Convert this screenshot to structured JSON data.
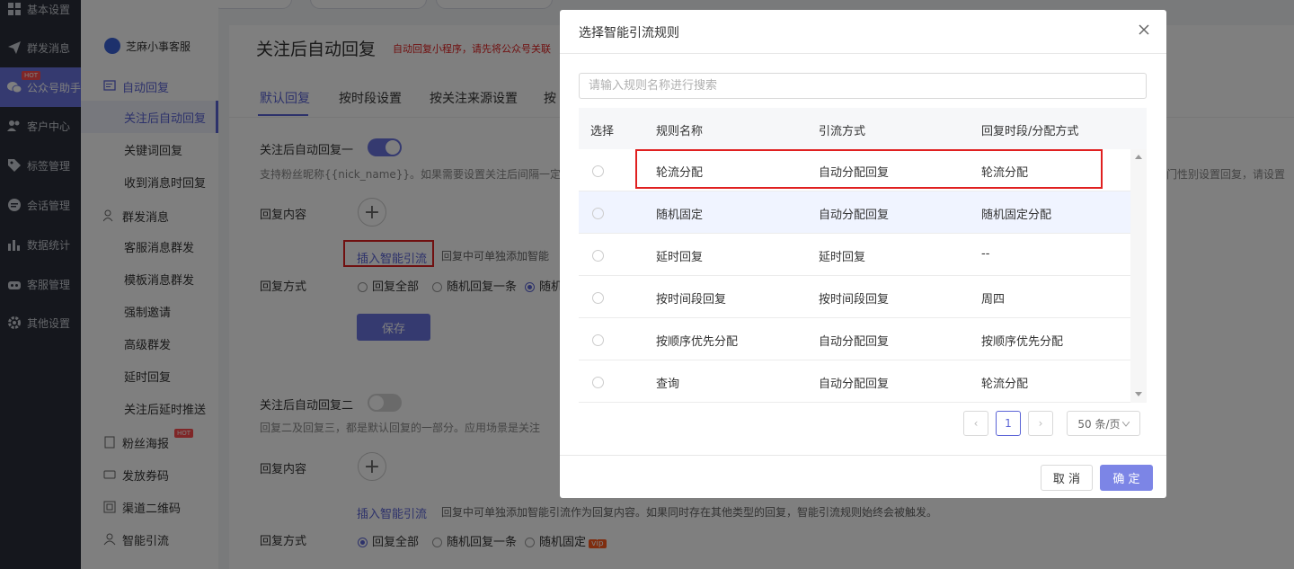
{
  "nav": {
    "items": [
      {
        "label": "基本设置",
        "icon": "grid-icon"
      },
      {
        "label": "群发消息",
        "icon": "send-icon"
      },
      {
        "label": "公众号助手",
        "icon": "wechat-icon",
        "badge": "HOT"
      },
      {
        "label": "客户中心",
        "icon": "users-icon"
      },
      {
        "label": "标签管理",
        "icon": "tag-icon"
      },
      {
        "label": "会话管理",
        "icon": "chat-icon"
      },
      {
        "label": "数据统计",
        "icon": "bar-chart-icon"
      },
      {
        "label": "客服管理",
        "icon": "robot-icon"
      },
      {
        "label": "其他设置",
        "icon": "gear-icon"
      }
    ]
  },
  "side": {
    "app_name": "芝麻小事客服",
    "items": [
      {
        "label": "自动回复",
        "type": "group"
      },
      {
        "label": "关注后自动回复",
        "type": "sub"
      },
      {
        "label": "关键词回复",
        "type": "sub"
      },
      {
        "label": "收到消息时回复",
        "type": "sub"
      },
      {
        "label": "群发消息",
        "type": "group"
      },
      {
        "label": "客服消息群发",
        "type": "sub"
      },
      {
        "label": "模板消息群发",
        "type": "sub"
      },
      {
        "label": "强制邀请",
        "type": "sub"
      },
      {
        "label": "高级群发",
        "type": "sub"
      },
      {
        "label": "延时回复",
        "type": "sub"
      },
      {
        "label": "关注后延时推送",
        "type": "sub"
      },
      {
        "label": "粉丝海报",
        "type": "group",
        "badge": "HOT"
      },
      {
        "label": "发放券码",
        "type": "group"
      },
      {
        "label": "渠道二维码",
        "type": "group"
      },
      {
        "label": "智能引流",
        "type": "group"
      }
    ]
  },
  "main": {
    "title": "关注后自动回复",
    "title_note": "自动回复小程序，请先将公众号关联",
    "tabs": [
      "默认回复",
      "按时段设置",
      "按关注来源设置",
      "按"
    ],
    "section1": {
      "label": "关注后自动回复一",
      "desc": "支持粉丝昵称{{nick_name}}。如果需要设置关注后间隔一定",
      "desc_right": "门性别设置回复，请设置",
      "content_label": "回复内容",
      "insert_link": "插入智能引流",
      "insert_note": "回复中可单独添加智能",
      "mode_label": "回复方式",
      "modes": [
        "回复全部",
        "随机回复一条",
        "随机"
      ],
      "save": "保存"
    },
    "section2": {
      "label": "关注后自动回复二",
      "desc": "回复二及回复三，都是默认回复的一部分。应用场景是关注",
      "content_label": "回复内容",
      "insert_link": "插入智能引流",
      "insert_note": "回复中可单独添加智能引流作为回复内容。如果同时存在其他类型的回复，智能引流规则始终会被触发。",
      "mode_label": "回复方式",
      "modes": [
        "回复全部",
        "随机回复一条",
        "随机固定"
      ],
      "vip": "vip"
    }
  },
  "dialog": {
    "title": "选择智能引流规则",
    "search_placeholder": "请输入规则名称进行搜索",
    "headers": [
      "选择",
      "规则名称",
      "引流方式",
      "回复时段/分配方式"
    ],
    "rows": [
      {
        "name": "轮流分配",
        "method": "自动分配回复",
        "period": "轮流分配"
      },
      {
        "name": "随机固定",
        "method": "自动分配回复",
        "period": "随机固定分配"
      },
      {
        "name": "延时回复",
        "method": "延时回复",
        "period": "--"
      },
      {
        "name": "按时间段回复",
        "method": "按时间段回复",
        "period": "周四"
      },
      {
        "name": "按顺序优先分配",
        "method": "自动分配回复",
        "period": "按顺序优先分配"
      },
      {
        "name": "查询",
        "method": "自动分配回复",
        "period": "轮流分配"
      }
    ],
    "pagination": {
      "prev": "‹",
      "page": "1",
      "next": "›",
      "page_size": "50 条/页"
    },
    "cancel": "取 消",
    "confirm": "确 定"
  },
  "colors": {
    "accent": "#5b64d6",
    "nav_bg": "#2b2f3a",
    "highlight_red": "#e02020"
  }
}
